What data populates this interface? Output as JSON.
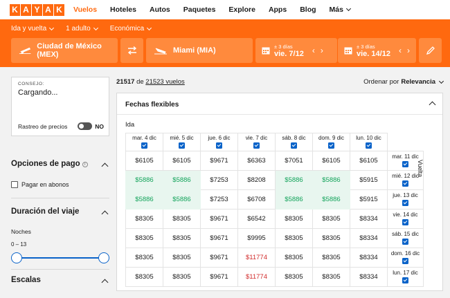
{
  "brand": {
    "logo_letters": [
      "K",
      "A",
      "Y",
      "A",
      "K"
    ],
    "accent": "#ff690f"
  },
  "nav": {
    "items": [
      {
        "label": "Vuelos",
        "active": true
      },
      {
        "label": "Hoteles"
      },
      {
        "label": "Autos"
      },
      {
        "label": "Paquetes"
      },
      {
        "label": "Explore"
      },
      {
        "label": "Apps"
      },
      {
        "label": "Blog"
      },
      {
        "label": "Más"
      }
    ]
  },
  "search": {
    "trip_type": "Ida y vuelta",
    "passengers": "1 adulto",
    "cabin": "Económica",
    "origin": "Ciudad de México (MEX)",
    "destination": "Miami (MIA)",
    "depart_flex": "± 3 días",
    "depart_date": "vie. 7/12",
    "return_flex": "± 3 días",
    "return_date": "vie. 14/12",
    "prev_glyph": "‹",
    "next_glyph": "›"
  },
  "sidebar": {
    "tip_label": "CONSEJO:",
    "tip_value": "Cargando...",
    "price_tracking_label": "Rastreo de precios",
    "price_tracking_state": "NO",
    "payment_title": "Opciones de pago",
    "payment_info": "i",
    "installments_label": "Pagar en abonos",
    "duration_title": "Duración del viaje",
    "nights_label": "Noches",
    "nights_range": "0 – 13",
    "stops_title": "Escalas"
  },
  "results": {
    "count": "21517",
    "of_word": "de",
    "total": "21523 vuelos",
    "sort_label": "Ordenar por",
    "sort_value": "Relevancia"
  },
  "flex_dates": {
    "title": "Fechas flexibles",
    "depart_axis": "Ida",
    "return_axis": "Vuelta",
    "depart_dates": [
      "mar. 4 dic",
      "mié. 5 dic",
      "jue. 6 dic",
      "vie. 7 dic",
      "sáb. 8 dic",
      "dom. 9 dic",
      "lun. 10 dic"
    ],
    "return_dates": [
      "mar. 11 dic",
      "mié. 12 dic",
      "jue. 13 dic",
      "vie. 14 dic",
      "sáb. 15 dic",
      "dom. 16 dic",
      "lun. 17 dic"
    ],
    "prices": [
      [
        "$6105",
        "$6105",
        "$9671",
        "$6363",
        "$7051",
        "$6105",
        "$6105"
      ],
      [
        "$5886",
        "$5886",
        "$7253",
        "$8208",
        "$5886",
        "$5886",
        "$5915"
      ],
      [
        "$5886",
        "$5886",
        "$7253",
        "$6708",
        "$5886",
        "$5886",
        "$5915"
      ],
      [
        "$8305",
        "$8305",
        "$9671",
        "$6542",
        "$8305",
        "$8305",
        "$8334"
      ],
      [
        "$8305",
        "$8305",
        "$9671",
        "$9995",
        "$8305",
        "$8305",
        "$8334"
      ],
      [
        "$8305",
        "$8305",
        "$9671",
        "$11774",
        "$8305",
        "$8305",
        "$8334"
      ],
      [
        "$8305",
        "$8305",
        "$9671",
        "$11774",
        "$8305",
        "$8305",
        "$8334"
      ]
    ],
    "cheap_color": "#12a35a",
    "expensive_color": "#d22d2d",
    "check_color": "#0a63c9"
  }
}
